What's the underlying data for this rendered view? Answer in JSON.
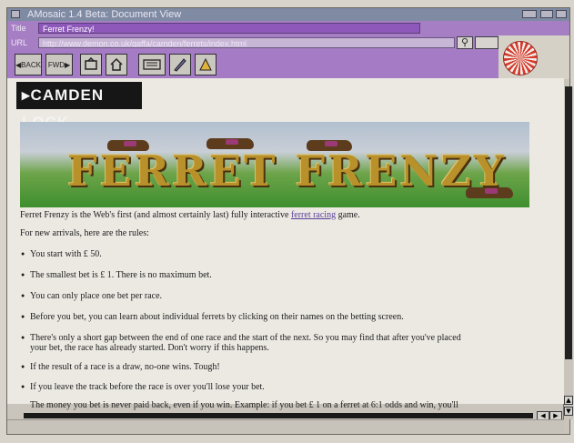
{
  "window": {
    "title": "AMosaic 1.4 Beta: Document View"
  },
  "title_row": {
    "label": "Title",
    "value": "Ferret Frenzy!"
  },
  "url_row": {
    "label": "URL",
    "value": "http://www.demon.co.uk/gaffa/camden/ferrets/index.html",
    "search_icon": "search-icon"
  },
  "toolbar": {
    "back_label": "BACK",
    "forward_label": "FWD",
    "buttons": [
      "back-icon",
      "forward-icon",
      "reload-icon",
      "home-icon",
      "hotlist-icon",
      "edit-icon",
      "annotate-icon"
    ]
  },
  "page": {
    "site_label": "CAMDEN LOCK",
    "banner_title": "FERRET FRENZY",
    "intro_before": "Ferret Frenzy is the Web's first (and almost certainly last) fully interactive ",
    "intro_link": "ferret racing",
    "intro_after": " game.",
    "rules_intro": "For new arrivals, here are the rules:",
    "rules": [
      "You start with £ 50.",
      "The smallest bet is £ 1. There is no maximum bet.",
      "You can only place one bet per race.",
      "Before you bet, you can learn about individual ferrets by clicking on their names on the betting screen.",
      "There's only a short gap between the end of one race and the start of the next. So you may find that after you've placed",
      "your bet, the race has already started. Don't worry if this happens.",
      "If the result of a race is a draw, no-one wins. Tough!",
      "If you leave the track before the race is over you'll lose your bet.",
      "The money you bet is never paid back, even if you win. Example: if you bet £ 1 on a ferret at 6:1 odds and win, you'll"
    ]
  }
}
